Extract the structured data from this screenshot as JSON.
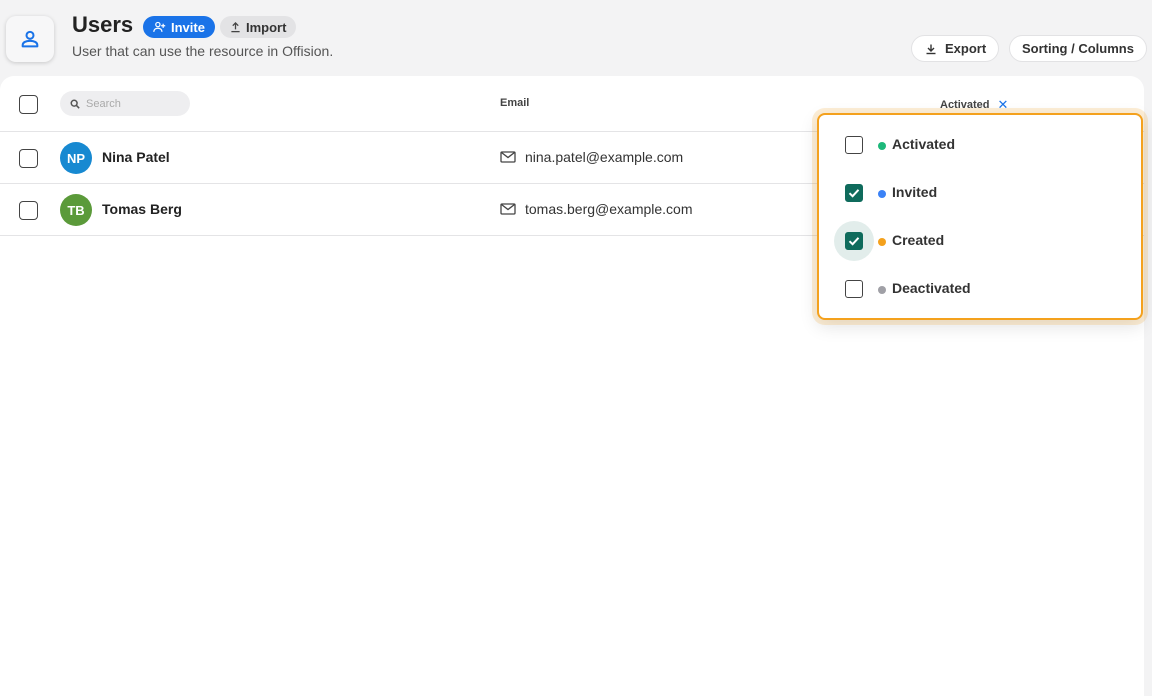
{
  "header": {
    "title": "Users",
    "subtitle": "User that can use the resource in Offision.",
    "invite_label": "Invite",
    "import_label": "Import",
    "export_label": "Export",
    "sorting_label": "Sorting / Columns"
  },
  "table": {
    "search_placeholder": "Search",
    "columns": {
      "email": "Email",
      "status": "Activated"
    },
    "rows": [
      {
        "initials": "NP",
        "name": "Nina Patel",
        "email": "nina.patel@example.com",
        "avatar_color": "#1789d1"
      },
      {
        "initials": "TB",
        "name": "Tomas Berg",
        "email": "tomas.berg@example.com",
        "avatar_color": "#5b9a3a"
      }
    ]
  },
  "status_filter": {
    "options": [
      {
        "label": "Activated",
        "checked": false,
        "color": "#1db87a"
      },
      {
        "label": "Invited",
        "checked": true,
        "color": "#3b82f6"
      },
      {
        "label": "Created",
        "checked": true,
        "color": "#f4a11d",
        "focused": true
      },
      {
        "label": "Deactivated",
        "checked": false,
        "color": "#a0a0a6"
      }
    ]
  },
  "colors": {
    "accent": "#1a73e8",
    "check": "#0f6b5c",
    "focus_ring": "#f4a11d"
  }
}
